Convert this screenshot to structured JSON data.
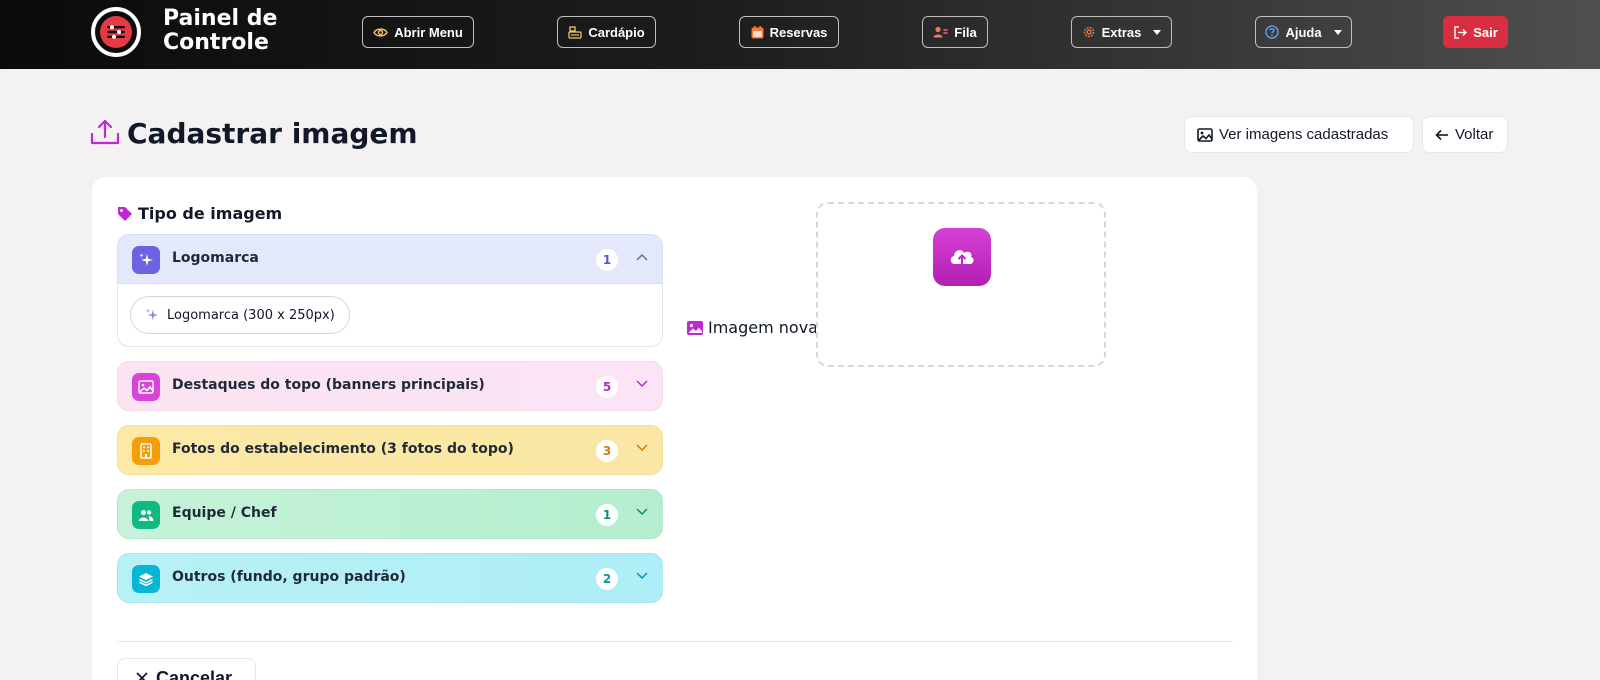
{
  "brand": {
    "title": "Painel de Controle"
  },
  "nav": {
    "open_menu": "Abrir Menu",
    "menu": "Cardápio",
    "reservations": "Reservas",
    "queue": "Fila",
    "extras": "Extras",
    "help": "Ajuda",
    "logout": "Sair"
  },
  "page": {
    "title": "Cadastrar imagem",
    "view_images": "Ver imagens cadastradas",
    "back": "Voltar"
  },
  "image_types": {
    "title": "Tipo de imagem",
    "groups": [
      {
        "label": "Logomarca",
        "count": "1",
        "expanded": true,
        "bg": "#e3e8fb",
        "icon_bg": "#6b63e0",
        "count_color": "#5b57c8",
        "icon": "sparkles-icon"
      },
      {
        "label": "Destaques do topo (banners principais)",
        "count": "5",
        "expanded": false,
        "bg": "#fbe3f1",
        "icon_bg": "#d844d8",
        "count_color": "#c026d3",
        "icon": "image-icon"
      },
      {
        "label": "Fotos do estabelecimento (3 fotos do topo)",
        "count": "3",
        "expanded": false,
        "bg": "#fde9a6",
        "icon_bg": "#f59e0b",
        "count_color": "#d97706",
        "icon": "building-icon"
      },
      {
        "label": "Equipe / Chef",
        "count": "1",
        "expanded": false,
        "bg": "#bff0d5",
        "icon_bg": "#10b981",
        "count_color": "#059669",
        "icon": "users-icon"
      },
      {
        "label": "Outros (fundo, grupo padrão)",
        "count": "2",
        "expanded": false,
        "bg": "#b2eef6",
        "icon_bg": "#06b6d4",
        "count_color": "#0891b2",
        "icon": "layers-icon"
      }
    ],
    "logomarca_option": "Logomarca (300 x 250px)"
  },
  "new_image": {
    "label": "Imagem nova"
  },
  "actions": {
    "cancel": "Cancelar"
  },
  "colors": {
    "accent": "#c026d3",
    "danger": "#d92e3f"
  }
}
